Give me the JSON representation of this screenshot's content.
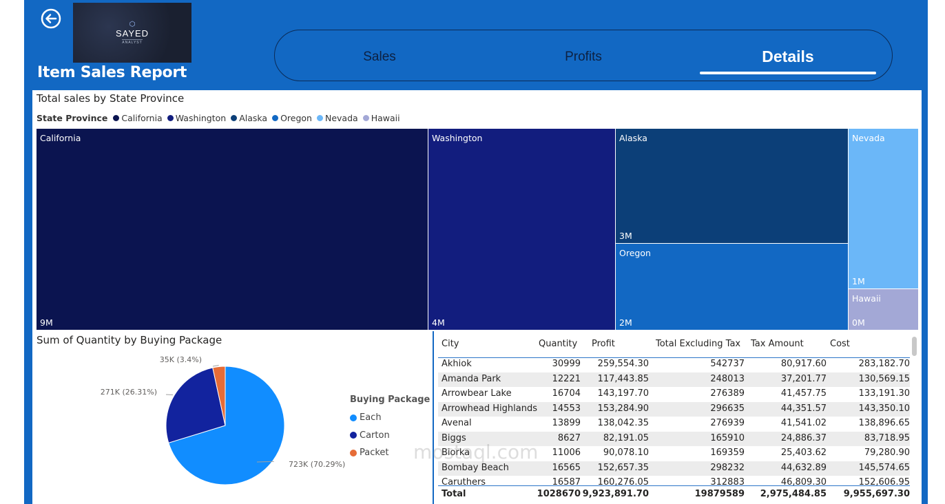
{
  "report": {
    "title": "Item Sales Report",
    "logo_name": "SAYED",
    "logo_sub": "ANALYST",
    "logo_mark": "⬡"
  },
  "nav": {
    "tabs": [
      {
        "label": "Sales",
        "active": false
      },
      {
        "label": "Profits",
        "active": false
      },
      {
        "label": "Details",
        "active": true
      }
    ]
  },
  "treemap": {
    "title": "Total sales by State Province",
    "legend_title": "State Province",
    "colors": {
      "California": "#0b1450",
      "Washington": "#121d7e",
      "Alaska": "#0c3f78",
      "Oregon": "#1268c3",
      "Nevada": "#6bb7f8",
      "Hawaii": "#a3a8d6"
    },
    "legend": [
      "California",
      "Washington",
      "Alaska",
      "Oregon",
      "Nevada",
      "Hawaii"
    ],
    "tiles": [
      {
        "name": "California",
        "value": "9M"
      },
      {
        "name": "Washington",
        "value": "4M"
      },
      {
        "name": "Alaska",
        "value": "3M"
      },
      {
        "name": "Oregon",
        "value": "2M"
      },
      {
        "name": "Nevada",
        "value": "1M"
      },
      {
        "name": "Hawaii",
        "value": "0M"
      }
    ]
  },
  "chart_data": {
    "type": "pie",
    "title": "Sum of Quantity by Buying Package",
    "legend_title": "Buying Package",
    "slices": [
      {
        "name": "Each",
        "value": 723,
        "label": "723K (70.29%)",
        "percent": 70.29,
        "color": "#118dff"
      },
      {
        "name": "Carton",
        "value": 271,
        "label": "271K (26.31%)",
        "percent": 26.31,
        "color": "#12239e"
      },
      {
        "name": "Packet",
        "value": 35,
        "label": "35K (3.4%)",
        "percent": 3.4,
        "color": "#e66c37"
      }
    ]
  },
  "table": {
    "headers": [
      "City",
      "Quantity",
      "Profit",
      "Total Excluding Tax",
      "Tax Amount",
      "Cost"
    ],
    "rows": [
      [
        "Akhiok",
        "30999",
        "259,554.30",
        "542737",
        "80,917.60",
        "283,182.70"
      ],
      [
        "Amanda Park",
        "12221",
        "117,443.85",
        "248013",
        "37,201.77",
        "130,569.15"
      ],
      [
        "Arrowbear Lake",
        "16704",
        "143,197.70",
        "276389",
        "41,457.75",
        "133,191.30"
      ],
      [
        "Arrowhead Highlands",
        "14553",
        "153,284.90",
        "296635",
        "44,351.57",
        "143,350.10"
      ],
      [
        "Avenal",
        "13899",
        "138,042.35",
        "276939",
        "41,541.02",
        "138,896.65"
      ],
      [
        "Biggs",
        "8627",
        "82,191.05",
        "165910",
        "24,886.37",
        "83,718.95"
      ],
      [
        "Biorka",
        "11006",
        "90,078.10",
        "169359",
        "25,403.62",
        "79,280.90"
      ],
      [
        "Bombay Beach",
        "16565",
        "152,657.35",
        "298232",
        "44,632.89",
        "145,574.65"
      ],
      [
        "Caruthers",
        "16587",
        "160,276.05",
        "312883",
        "46,809.30",
        "152,606.95"
      ]
    ],
    "total": [
      "Total",
      "1028670",
      "9,923,891.70",
      "19879589",
      "2,975,484.85",
      "9,955,697.30"
    ]
  },
  "watermark": "mostaql.com"
}
